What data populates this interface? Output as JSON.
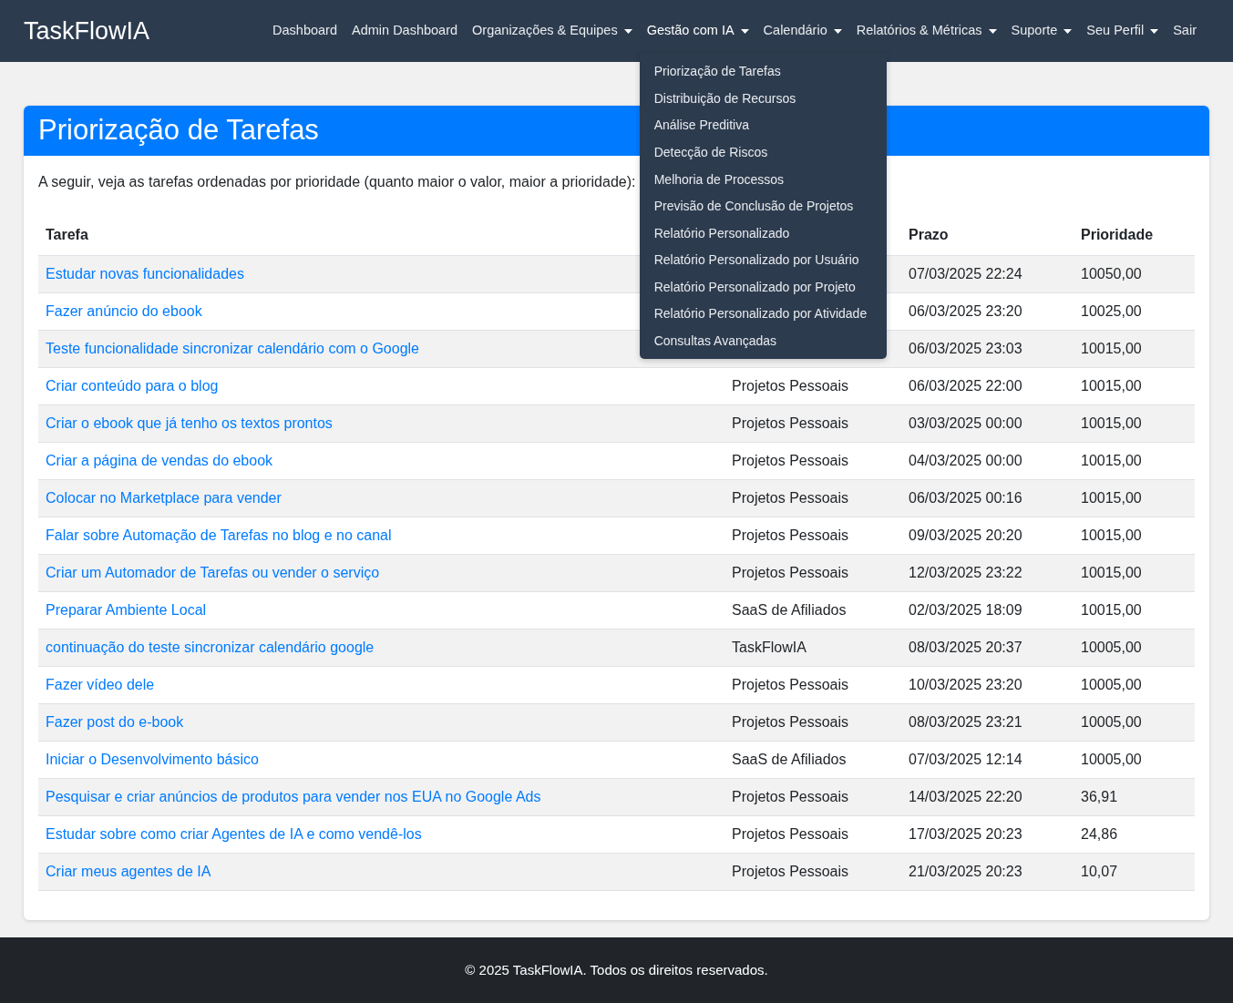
{
  "navbar": {
    "brand": "TaskFlowIA",
    "items": [
      {
        "label": "Dashboard",
        "kind": "link",
        "expanded": false
      },
      {
        "label": "Admin Dashboard",
        "kind": "link",
        "expanded": false
      },
      {
        "label": "Organizações & Equipes",
        "kind": "dropdown",
        "expanded": false
      },
      {
        "label": "Gestão com IA",
        "kind": "dropdown",
        "expanded": true,
        "menu": [
          "Priorização de Tarefas",
          "Distribuição de Recursos",
          "Análise Preditiva",
          "Detecção de Riscos",
          "Melhoria de Processos",
          "Previsão de Conclusão de Projetos",
          "Relatório Personalizado",
          "Relatório Personalizado por Usuário",
          "Relatório Personalizado por Projeto",
          "Relatório Personalizado por Atividade",
          "Consultas Avançadas"
        ]
      },
      {
        "label": "Calendário",
        "kind": "dropdown",
        "expanded": false
      },
      {
        "label": "Relatórios & Métricas",
        "kind": "dropdown",
        "expanded": false
      },
      {
        "label": "Suporte",
        "kind": "dropdown",
        "expanded": false
      },
      {
        "label": "Seu Perfil",
        "kind": "dropdown",
        "expanded": false
      },
      {
        "label": "Sair",
        "kind": "link",
        "expanded": false
      }
    ]
  },
  "card": {
    "title": "Priorização de Tarefas",
    "description": "A seguir, veja as tarefas ordenadas por prioridade (quanto maior o valor, maior a prioridade):",
    "table": {
      "columns": [
        "Tarefa",
        "",
        "Prazo",
        "Prioridade"
      ],
      "rows": [
        {
          "task": "Estudar novas funcionalidades",
          "due": "07/03/2025 22:24",
          "priority": "10050,00"
        },
        {
          "task": "Fazer anúncio do ebook",
          "due": "06/03/2025 23:20",
          "priority": "10025,00"
        },
        {
          "task": "Teste funcionalidade sincronizar calendário com o Google",
          "due": "06/03/2025 23:03",
          "priority": "10015,00"
        },
        {
          "task": "Criar conteúdo para o blog",
          "project": "Projetos Pessoais",
          "due": "06/03/2025 22:00",
          "priority": "10015,00"
        },
        {
          "task": "Criar o ebook que já tenho os textos prontos",
          "project": "Projetos Pessoais",
          "due": "03/03/2025 00:00",
          "priority": "10015,00"
        },
        {
          "task": "Criar a página de vendas do ebook",
          "project": "Projetos Pessoais",
          "due": "04/03/2025 00:00",
          "priority": "10015,00"
        },
        {
          "task": "Colocar no Marketplace para vender",
          "project": "Projetos Pessoais",
          "due": "06/03/2025 00:16",
          "priority": "10015,00"
        },
        {
          "task": "Falar sobre Automação de Tarefas no blog e no canal",
          "project": "Projetos Pessoais",
          "due": "09/03/2025 20:20",
          "priority": "10015,00"
        },
        {
          "task": "Criar um Automador de Tarefas ou vender o serviço",
          "project": "Projetos Pessoais",
          "due": "12/03/2025 23:22",
          "priority": "10015,00"
        },
        {
          "task": "Preparar Ambiente Local",
          "project": "SaaS de Afiliados",
          "due": "02/03/2025 18:09",
          "priority": "10015,00"
        },
        {
          "task": "continuação do teste sincronizar calendário google",
          "project": "TaskFlowIA",
          "due": "08/03/2025 20:37",
          "priority": "10005,00"
        },
        {
          "task": "Fazer vídeo dele",
          "project": "Projetos Pessoais",
          "due": "10/03/2025 23:20",
          "priority": "10005,00"
        },
        {
          "task": "Fazer post do e-book",
          "project": "Projetos Pessoais",
          "due": "08/03/2025 23:21",
          "priority": "10005,00"
        },
        {
          "task": "Iniciar o Desenvolvimento básico",
          "project": "SaaS de Afiliados",
          "due": "07/03/2025 12:14",
          "priority": "10005,00"
        },
        {
          "task": "Pesquisar e criar anúncios de produtos para vender nos EUA no Google Ads",
          "project": "Projetos Pessoais",
          "due": "14/03/2025 22:20",
          "priority": "36,91"
        },
        {
          "task": "Estudar sobre como criar Agentes de IA e como vendê-los",
          "project": "Projetos Pessoais",
          "due": "17/03/2025 20:23",
          "priority": "24,86"
        },
        {
          "task": "Criar meus agentes de IA",
          "project": "Projetos Pessoais",
          "due": "21/03/2025 20:23",
          "priority": "10,07"
        }
      ]
    }
  },
  "footer": {
    "text": "© 2025 TaskFlowIA. Todos os direitos reservados."
  }
}
